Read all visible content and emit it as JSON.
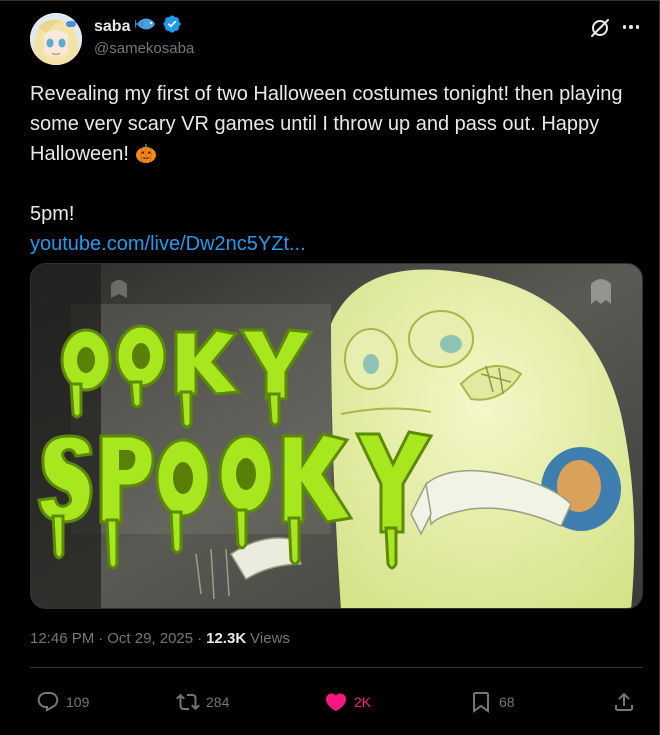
{
  "author": {
    "display_name": "saba",
    "handle": "@samekosaba",
    "name_emoji": "fish-emoji",
    "verified": true
  },
  "header_actions": {
    "grok_icon": "grok-icon",
    "more_icon": "more-dots-icon"
  },
  "tweet": {
    "line1": "Revealing my first of two Halloween costumes tonight! then playing some very scary VR games until I throw up and pass out. Happy Halloween!",
    "emoji": "jack-o-lantern-emoji",
    "line2": "5pm!",
    "link": "youtube.com/live/Dw2nc5YZt..."
  },
  "media": {
    "description_icon": "halloween-stream-thumbnail",
    "overlay_text": "OOKY SPOOKY"
  },
  "meta": {
    "time": "12:46 PM",
    "separator": "·",
    "date": "Oct 29, 2025",
    "views_count": "12.3K",
    "views_label": "Views"
  },
  "actions": {
    "replies": "109",
    "reposts": "284",
    "likes": "2K",
    "bookmarks": "68"
  },
  "colors": {
    "background": "#000000",
    "text": "#e7e9ea",
    "muted": "#71767b",
    "link": "#1d9bf0",
    "like": "#f91880",
    "verified": "#1d9bf0",
    "slime": "#a8e61d"
  }
}
